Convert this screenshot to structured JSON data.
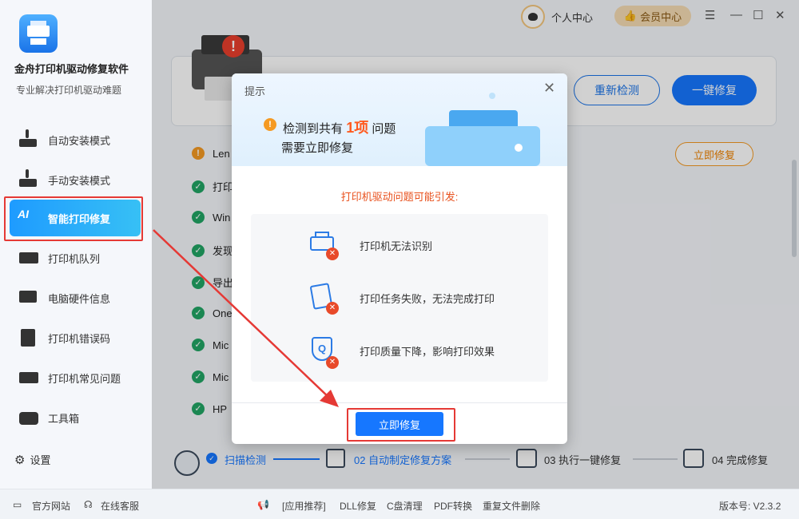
{
  "app": {
    "title": "金舟打印机驱动修复软件",
    "subtitle": "专业解决打印机驱动难题",
    "version_label": "版本号: V2.3.2"
  },
  "sidebar": {
    "items": [
      {
        "label": "自动安装模式",
        "icon": "download-printer-icon"
      },
      {
        "label": "手动安装模式",
        "icon": "manual-install-icon"
      },
      {
        "label": "智能打印修复",
        "icon": "ai-repair-icon"
      },
      {
        "label": "打印机队列",
        "icon": "print-queue-icon"
      },
      {
        "label": "电脑硬件信息",
        "icon": "hardware-info-icon"
      },
      {
        "label": "打印机错误码",
        "icon": "error-code-icon"
      },
      {
        "label": "打印机常见问题",
        "icon": "faq-icon"
      },
      {
        "label": "工具箱",
        "icon": "toolbox-icon"
      }
    ],
    "settings_label": "设置"
  },
  "topbar": {
    "user_label": "个人中心",
    "vip_label": "会员中心"
  },
  "main": {
    "rescan_label": "重新检测",
    "onekey_label": "一键修复",
    "fix_now_label": "立即修复",
    "rows": [
      "Len",
      "打印",
      "Win",
      "发现",
      "导出",
      "One",
      "Mic",
      "Mic",
      "HP"
    ]
  },
  "steps": [
    {
      "label": "扫描检测",
      "state": "done"
    },
    {
      "label": "02 自动制定修复方案",
      "state": "active"
    },
    {
      "label": "03 执行一键修复",
      "state": "pending"
    },
    {
      "label": "04 完成修复",
      "state": "pending"
    }
  ],
  "footer": {
    "official_site": "官方网站",
    "online_service": "在线客服",
    "recommend": "[应用推荐]",
    "dll_fix": "DLL修复",
    "c_clean": "C盘清理",
    "pdf_convert": "PDF转换",
    "dup_delete": "重复文件删除"
  },
  "dialog": {
    "title": "提示",
    "msg_prefix": "检测到共有",
    "msg_count": "1项",
    "msg_suffix": "问题",
    "msg_line2": "需要立即修复",
    "subtitle": "打印机驱动问题可能引发:",
    "issues": [
      "打印机无法识别",
      "打印任务失败，无法完成打印",
      "打印质量下降，影响打印效果"
    ],
    "button_label": "立即修复"
  },
  "colors": {
    "primary": "#1677ff",
    "warning": "#f59a23",
    "error": "#e84a2a",
    "success": "#22a565",
    "highlight_red": "#e53935"
  }
}
